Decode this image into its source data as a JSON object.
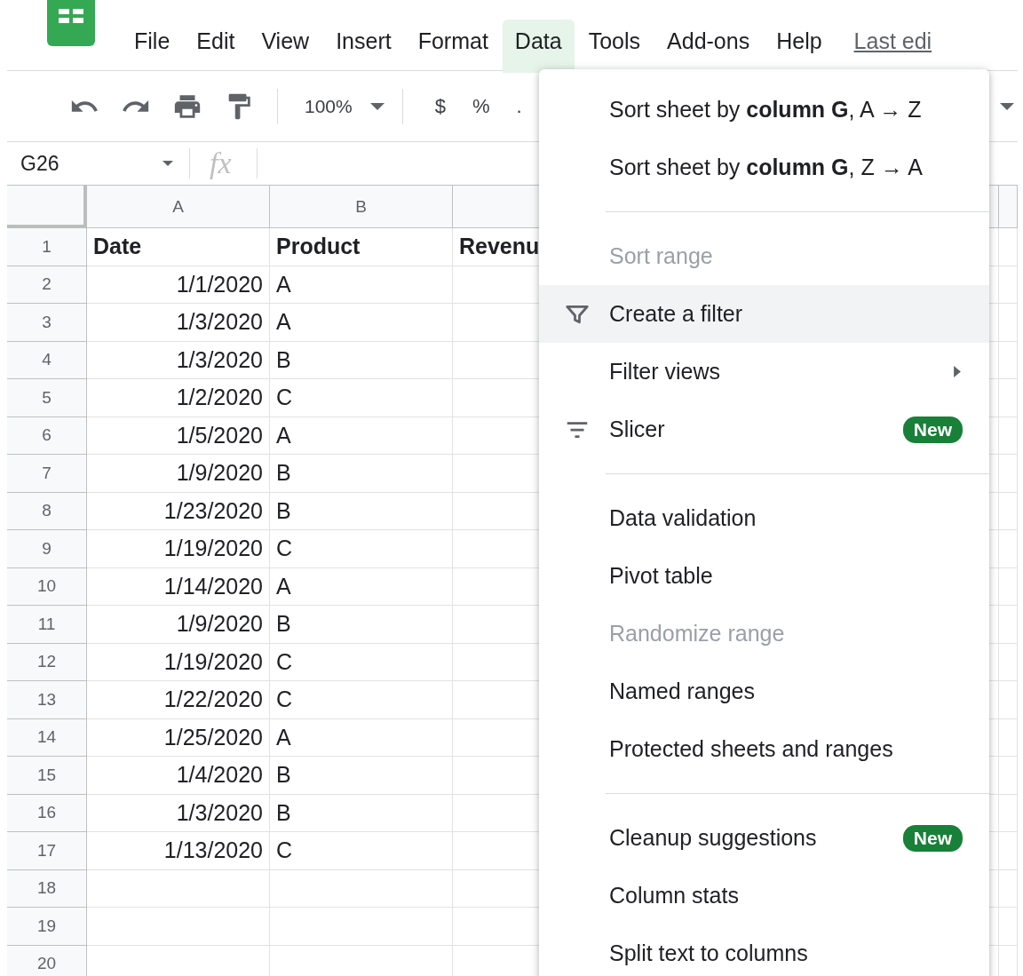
{
  "menubar": {
    "items": [
      {
        "label": "File",
        "selected": false
      },
      {
        "label": "Edit",
        "selected": false
      },
      {
        "label": "View",
        "selected": false
      },
      {
        "label": "Insert",
        "selected": false
      },
      {
        "label": "Format",
        "selected": false
      },
      {
        "label": "Data",
        "selected": true
      },
      {
        "label": "Tools",
        "selected": false
      },
      {
        "label": "Add-ons",
        "selected": false
      },
      {
        "label": "Help",
        "selected": false
      }
    ],
    "last_edit_link": "Last edi"
  },
  "toolbar": {
    "zoom": "100%",
    "format_buttons": [
      "$",
      "%",
      "."
    ]
  },
  "formula_bar": {
    "name_box": "G26",
    "fx_label": "fx"
  },
  "sheet": {
    "columns": [
      "A",
      "B",
      ""
    ],
    "rows": [
      {
        "number": "1",
        "kind": "header",
        "cells": [
          "Date",
          "Product",
          "Revenu"
        ]
      },
      {
        "number": "2",
        "kind": "data",
        "cells": [
          "1/1/2020",
          "A"
        ]
      },
      {
        "number": "3",
        "kind": "data",
        "cells": [
          "1/3/2020",
          "A"
        ]
      },
      {
        "number": "4",
        "kind": "data",
        "cells": [
          "1/3/2020",
          "B"
        ]
      },
      {
        "number": "5",
        "kind": "data",
        "cells": [
          "1/2/2020",
          "C"
        ]
      },
      {
        "number": "6",
        "kind": "data",
        "cells": [
          "1/5/2020",
          "A"
        ]
      },
      {
        "number": "7",
        "kind": "data",
        "cells": [
          "1/9/2020",
          "B"
        ]
      },
      {
        "number": "8",
        "kind": "data",
        "cells": [
          "1/23/2020",
          "B"
        ]
      },
      {
        "number": "9",
        "kind": "data",
        "cells": [
          "1/19/2020",
          "C"
        ]
      },
      {
        "number": "10",
        "kind": "data",
        "cells": [
          "1/14/2020",
          "A"
        ]
      },
      {
        "number": "11",
        "kind": "data",
        "cells": [
          "1/9/2020",
          "B"
        ]
      },
      {
        "number": "12",
        "kind": "data",
        "cells": [
          "1/19/2020",
          "C"
        ]
      },
      {
        "number": "13",
        "kind": "data",
        "cells": [
          "1/22/2020",
          "C"
        ]
      },
      {
        "number": "14",
        "kind": "data",
        "cells": [
          "1/25/2020",
          "A"
        ]
      },
      {
        "number": "15",
        "kind": "data",
        "cells": [
          "1/4/2020",
          "B"
        ]
      },
      {
        "number": "16",
        "kind": "data",
        "cells": [
          "1/3/2020",
          "B"
        ]
      },
      {
        "number": "17",
        "kind": "data",
        "cells": [
          "1/13/2020",
          "C"
        ]
      },
      {
        "number": "18",
        "kind": "data",
        "cells": []
      },
      {
        "number": "19",
        "kind": "data",
        "cells": []
      },
      {
        "number": "20",
        "kind": "data",
        "cells": []
      }
    ]
  },
  "data_menu": {
    "items": [
      {
        "kind": "item",
        "label": "Sort sheet by **column G**, A → Z",
        "disabled": false,
        "selected": false
      },
      {
        "kind": "item",
        "label": "Sort sheet by **column G**, Z → A",
        "disabled": false,
        "selected": false
      },
      {
        "kind": "separator"
      },
      {
        "kind": "item",
        "label": "Sort range",
        "disabled": true,
        "selected": false
      },
      {
        "kind": "filter",
        "label": "Create a filter",
        "disabled": false,
        "selected": true
      },
      {
        "kind": "item",
        "label": "Filter views",
        "submenu": true,
        "disabled": false,
        "selected": false
      },
      {
        "kind": "slicer",
        "label": "Slicer",
        "badge": "New",
        "disabled": false,
        "selected": false
      },
      {
        "kind": "separator"
      },
      {
        "kind": "item",
        "label": "Data validation",
        "disabled": false,
        "selected": false
      },
      {
        "kind": "item",
        "label": "Pivot table",
        "disabled": false,
        "selected": false
      },
      {
        "kind": "item",
        "label": "Randomize range",
        "disabled": true,
        "selected": false
      },
      {
        "kind": "item",
        "label": "Named ranges",
        "disabled": false,
        "selected": false
      },
      {
        "kind": "item",
        "label": "Protected sheets and ranges",
        "disabled": false,
        "selected": false
      },
      {
        "kind": "separator"
      },
      {
        "kind": "item",
        "label": "Cleanup suggestions",
        "badge": "New",
        "disabled": false,
        "selected": false
      },
      {
        "kind": "item",
        "label": "Column stats",
        "disabled": false,
        "selected": false
      },
      {
        "kind": "item",
        "label": "Split text to columns",
        "disabled": false,
        "selected": false
      }
    ]
  }
}
